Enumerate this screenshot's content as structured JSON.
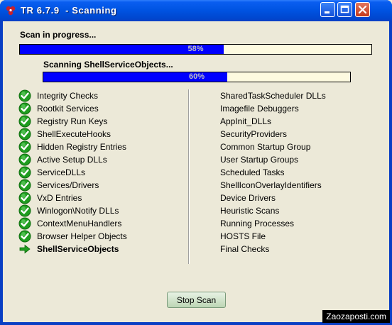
{
  "window": {
    "title": "TR 6.7.9  - Scanning"
  },
  "overall": {
    "label": "Scan in progress...",
    "percent": 58,
    "percent_text": "58%"
  },
  "current": {
    "label": "Scanning ShellServiceObjects...",
    "percent": 60,
    "percent_text": "60%"
  },
  "left_items": [
    {
      "label": "Integrity Checks",
      "status": "done"
    },
    {
      "label": "Rootkit Services",
      "status": "done"
    },
    {
      "label": "Registry Run Keys",
      "status": "done"
    },
    {
      "label": "ShellExecuteHooks",
      "status": "done"
    },
    {
      "label": "Hidden Registry Entries",
      "status": "done"
    },
    {
      "label": "Active Setup DLLs",
      "status": "done"
    },
    {
      "label": "ServiceDLLs",
      "status": "done"
    },
    {
      "label": "Services/Drivers",
      "status": "done"
    },
    {
      "label": "VxD Entries",
      "status": "done"
    },
    {
      "label": "Winlogon\\Notify DLLs",
      "status": "done"
    },
    {
      "label": "ContextMenuHandlers",
      "status": "done"
    },
    {
      "label": "Browser Helper Objects",
      "status": "done"
    },
    {
      "label": "ShellServiceObjects",
      "status": "current"
    }
  ],
  "right_items": [
    "SharedTaskScheduler DLLs",
    "Imagefile Debuggers",
    "AppInit_DLLs",
    "SecurityProviders",
    "Common Startup Group",
    "User Startup Groups",
    "Scheduled Tasks",
    "ShellIconOverlayIdentifiers",
    "Device Drivers",
    "Heuristic Scans",
    "Running Processes",
    "HOSTS File",
    "Final Checks"
  ],
  "buttons": {
    "stop": "Stop Scan"
  },
  "watermark": "Zaozaposti.com",
  "colors": {
    "progress_fill": "#0000ff",
    "progress_track": "#fdfae0",
    "check_green": "#1f9d1f",
    "title_blue": "#0054e3"
  }
}
